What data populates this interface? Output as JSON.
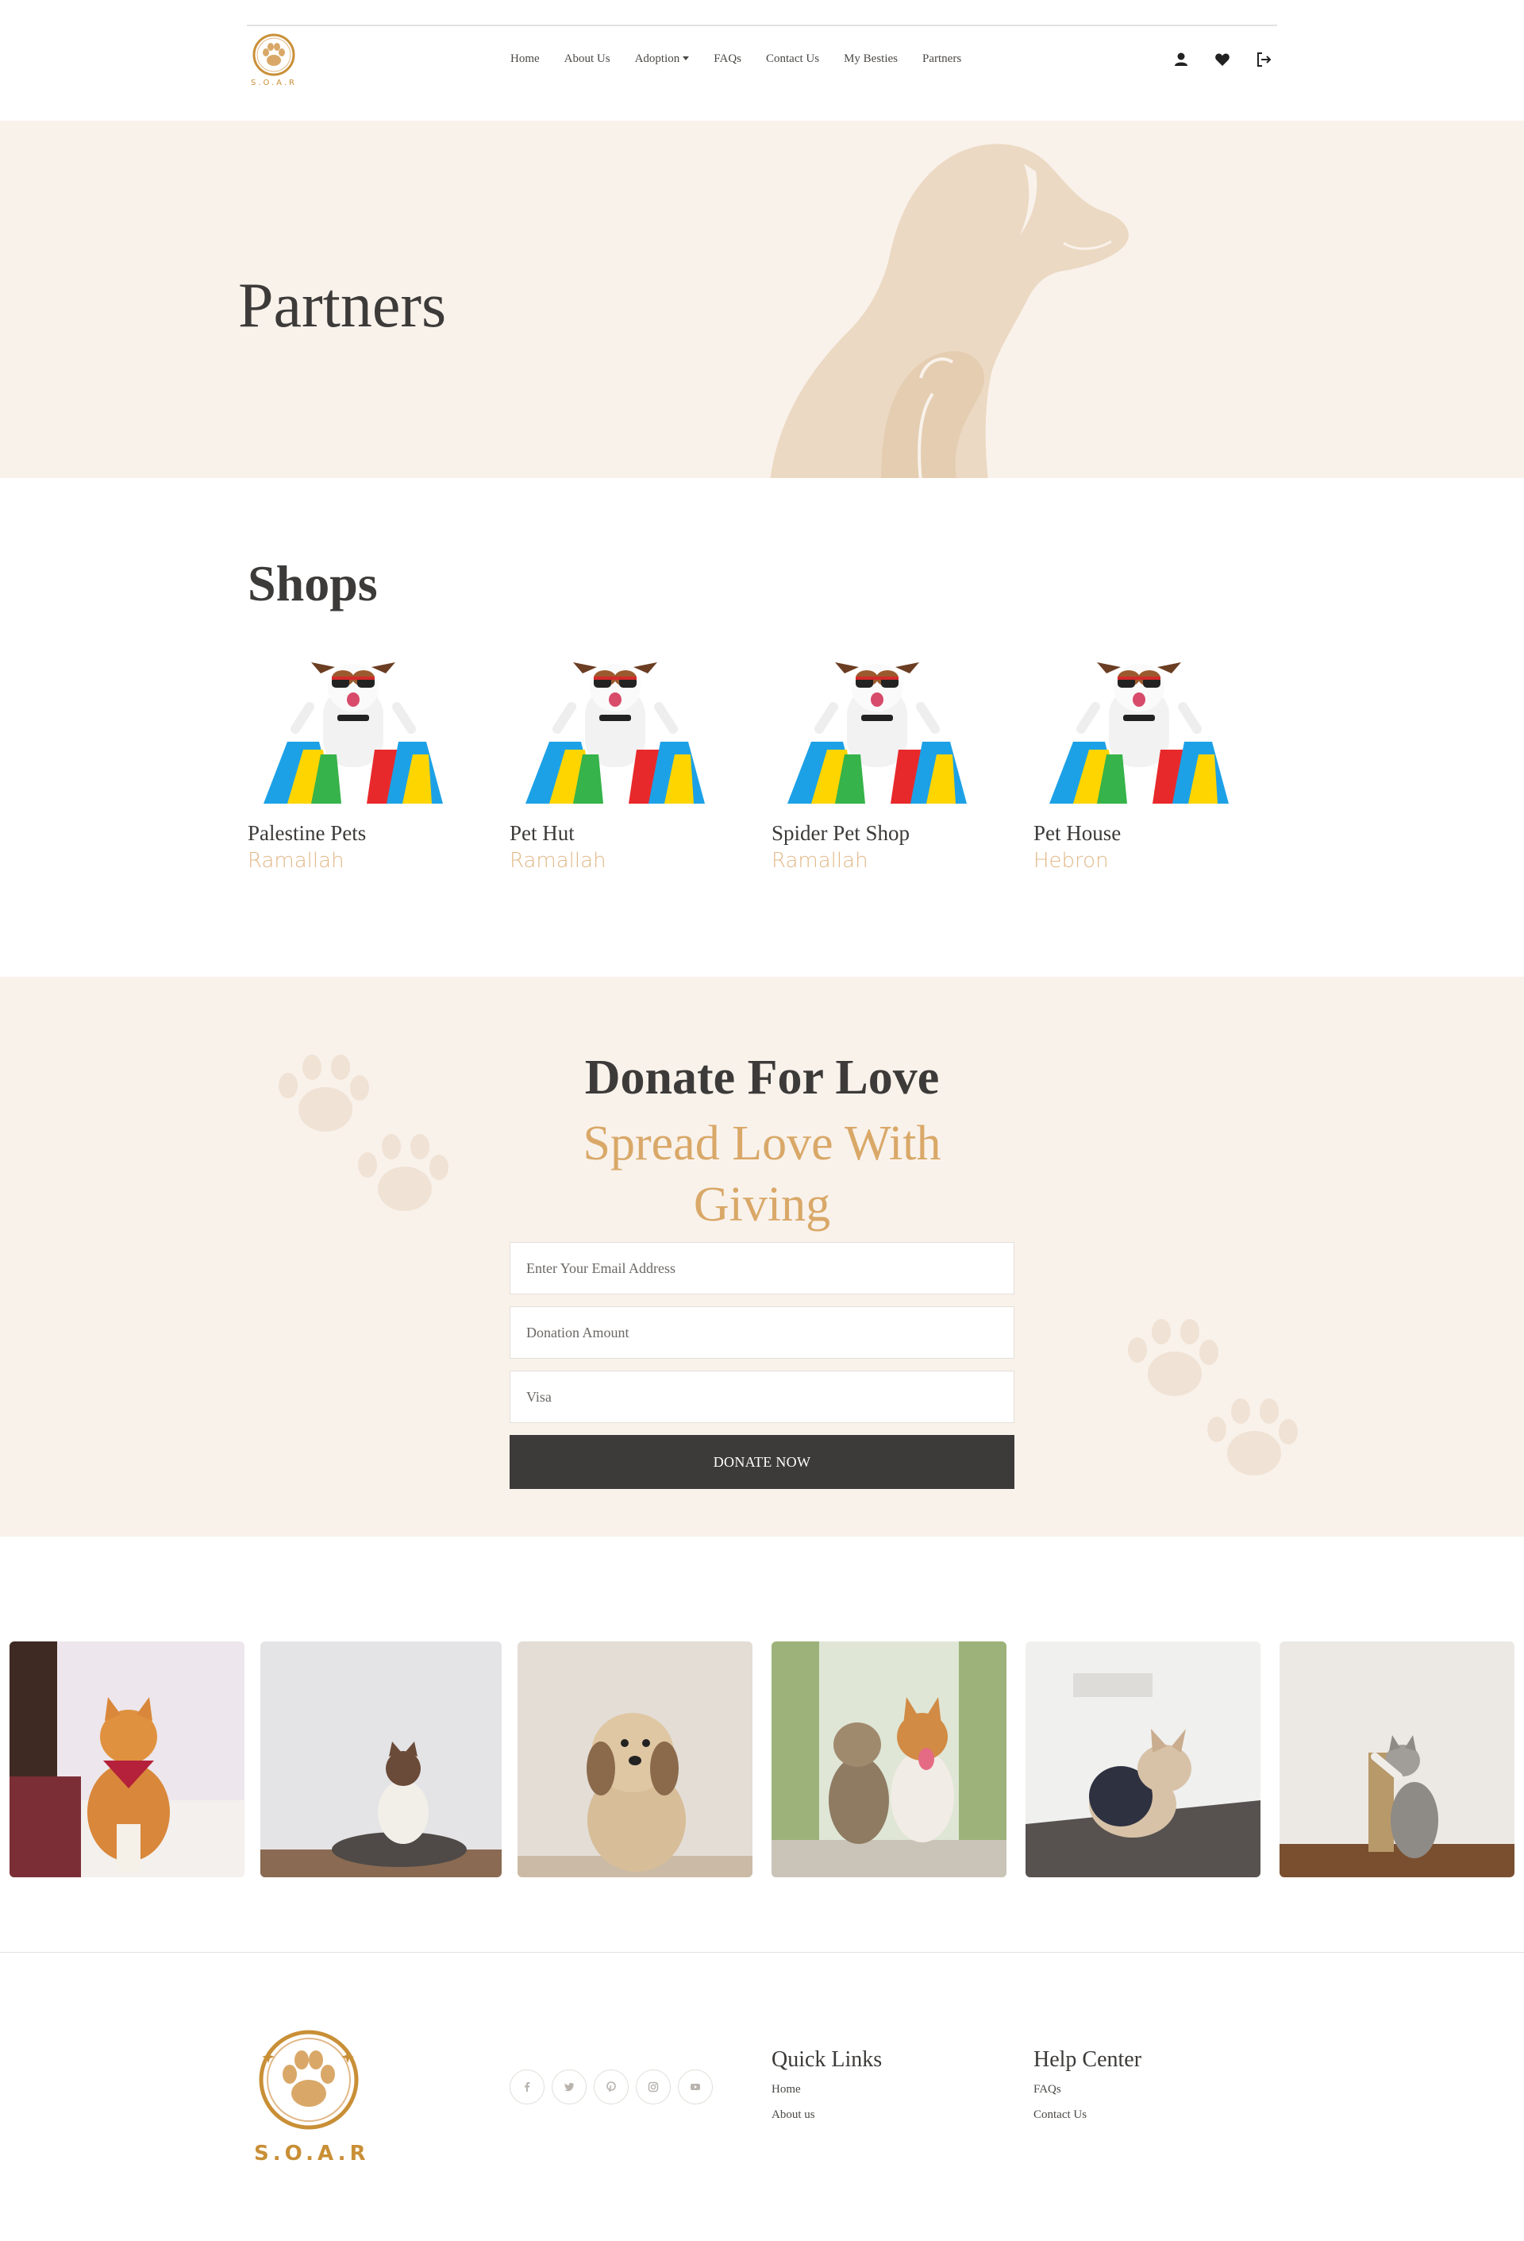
{
  "brand": {
    "name": "S.O.A.R"
  },
  "nav": {
    "links": [
      "Home",
      "About Us",
      "Adoption",
      "FAQs",
      "Contact Us",
      "My Besties",
      "Partners"
    ]
  },
  "hero": {
    "title": "Partners"
  },
  "shops": {
    "title": "Shops",
    "items": [
      {
        "name": "Palestine Pets",
        "city": "Ramallah"
      },
      {
        "name": "Pet Hut",
        "city": "Ramallah"
      },
      {
        "name": "Spider Pet Shop",
        "city": "Ramallah"
      },
      {
        "name": "Pet House",
        "city": "Hebron"
      }
    ]
  },
  "donate": {
    "title": "Donate For Love",
    "subtitle": "Spread Love With Giving",
    "email_placeholder": "Enter Your Email Address",
    "amount_placeholder": "Donation Amount",
    "visa_placeholder": "Visa",
    "button": "DONATE NOW"
  },
  "footer": {
    "quick_links_title": "Quick Links",
    "quick_links": [
      "Home",
      "About us"
    ],
    "help_title": "Help Center",
    "help_links": [
      "FAQs",
      "Contact Us"
    ]
  },
  "colors": {
    "accent": "#d9a868",
    "dark": "#3d3b39",
    "cream": "#f9f2eb",
    "gold": "#c98f36"
  }
}
